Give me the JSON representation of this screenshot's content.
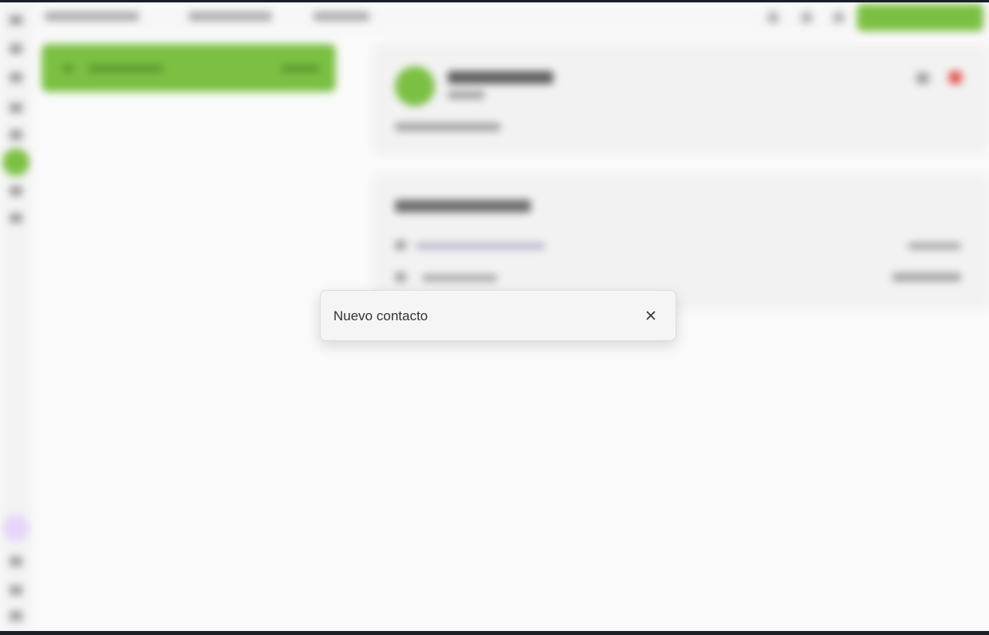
{
  "dialog": {
    "title": "Nuevo contacto",
    "close_icon": "close-icon"
  },
  "background": {
    "state": "blurred",
    "accent_color": "#7bc043",
    "danger_color": "#e2584f",
    "avatar_color": "#e7d6fb"
  }
}
